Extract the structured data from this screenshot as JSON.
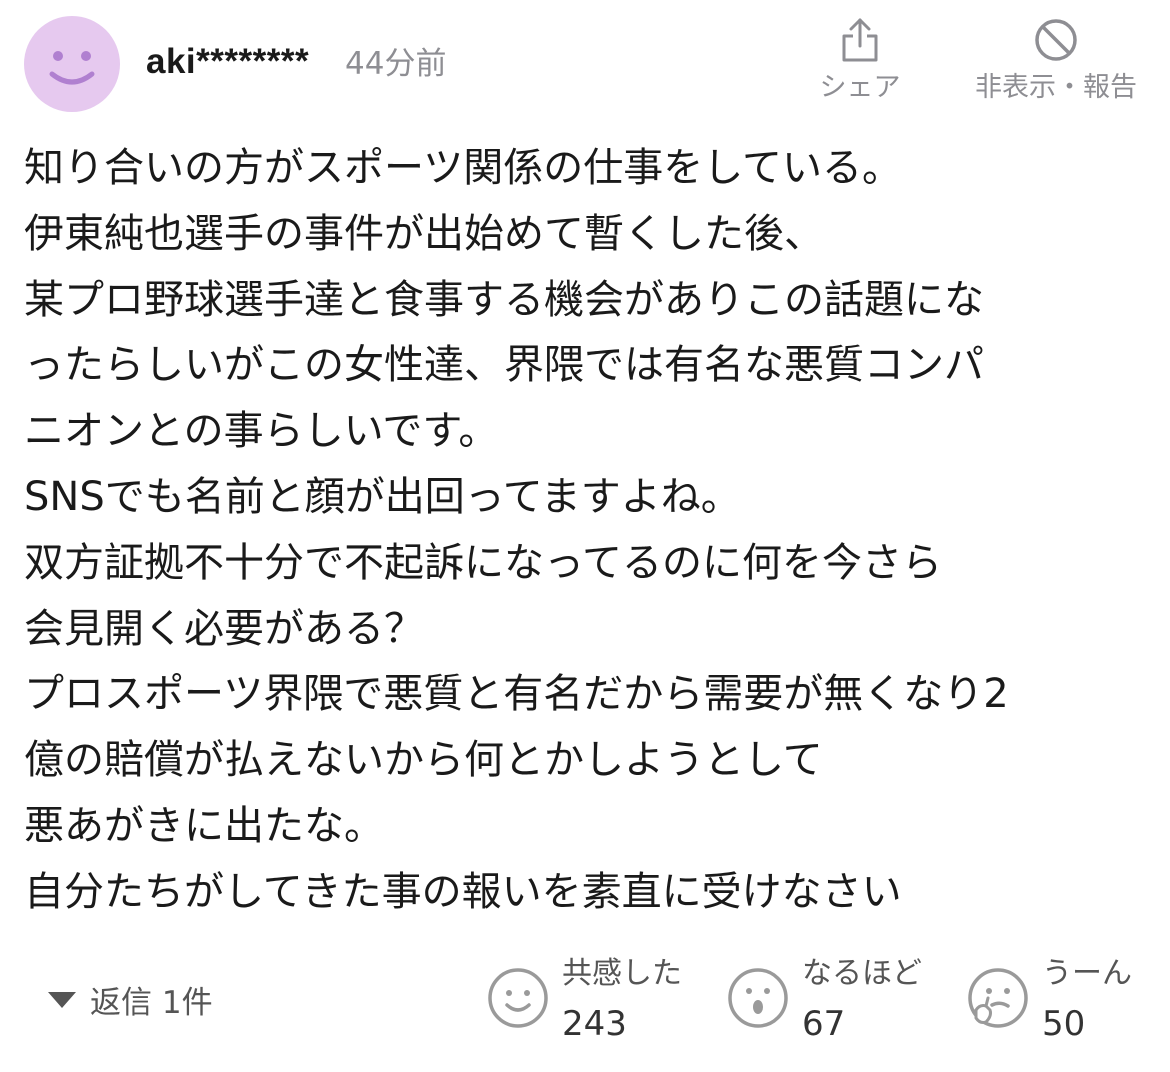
{
  "comment": {
    "username": "aki********",
    "timestamp": "44分前",
    "share_label": "シェア",
    "hide_report_label": "非表示・報告",
    "lines": [
      "知り合いの方がスポーツ関係の仕事をしている。",
      "伊東純也選手の事件が出始めて暫くした後、",
      "某プロ野球選手達と食事する機会がありこの話題にな",
      "ったらしいがこの女性達、界隈では有名な悪質コンパ",
      "ニオンとの事らしいです。",
      "SNSでも名前と顔が出回ってますよね。",
      "双方証拠不十分で不起訴になってるのに何を今さら",
      "会見開く必要がある？",
      "プロスポーツ界隈で悪質と有名だから需要が無くなり2",
      "億の賠償が払えないから何とかしようとして",
      "悪あがきに出たな。",
      "自分たちがしてきた事の報いを素直に受けなさい"
    ],
    "reply_label": "返信 1件",
    "reactions": [
      {
        "label": "共感した",
        "count": "243",
        "icon": "smile-face-icon"
      },
      {
        "label": "なるほど",
        "count": "67",
        "icon": "surprised-face-icon"
      },
      {
        "label": "うーん",
        "count": "50",
        "icon": "thinking-face-icon"
      }
    ]
  },
  "colors": {
    "avatar_bg": "#e6c9ef",
    "avatar_features": "#b080d0",
    "muted_text": "#8e8e93",
    "body_text": "#1a1a1a",
    "reaction_icon": "#9a9a9a"
  },
  "icons": {
    "avatar": "smiley-avatar-icon",
    "share": "share-icon",
    "hide_report": "prohibited-icon",
    "reply_toggle": "triangle-down-icon"
  }
}
